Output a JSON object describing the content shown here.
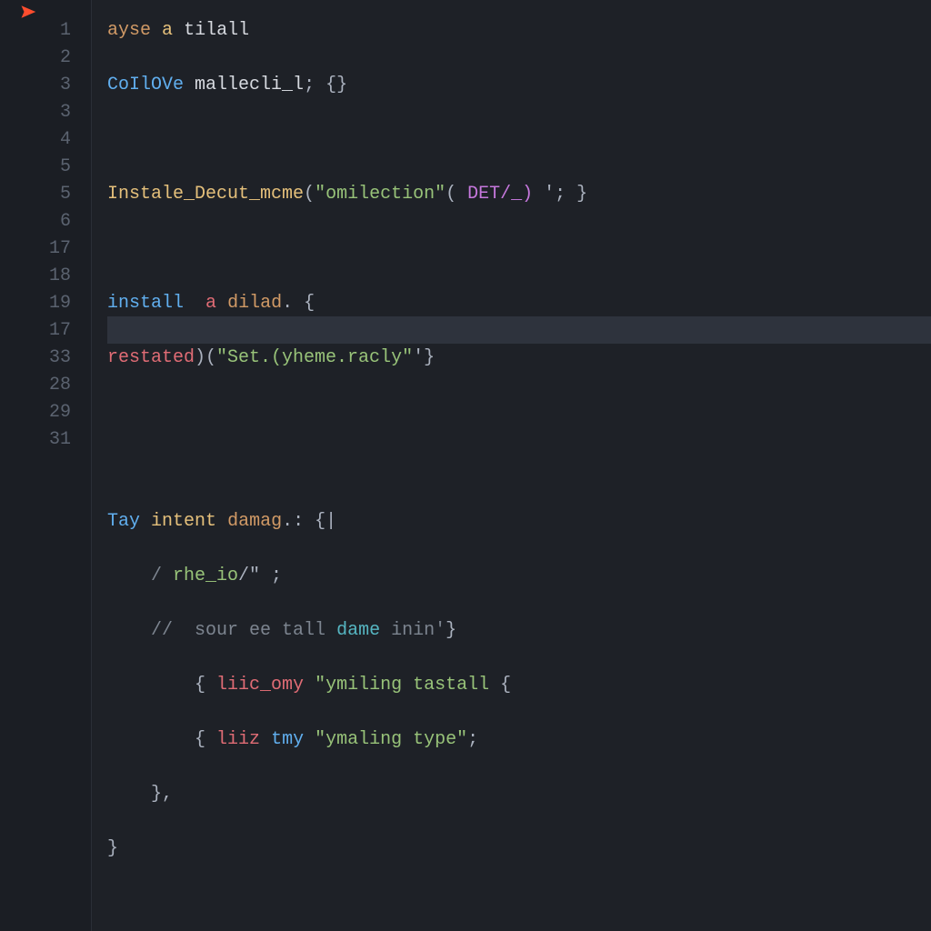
{
  "icon": {
    "name": "cursor-icon"
  },
  "gutter": {
    "numbers": [
      "1",
      "2",
      "3",
      "3",
      "4",
      "5",
      "5",
      "6",
      "17",
      "18",
      "19",
      "17",
      "33",
      "28",
      "29",
      "31"
    ]
  },
  "highlight": {
    "lineIndex": 11
  },
  "code": {
    "lines": [
      {
        "indent": 0,
        "tokens": [
          {
            "t": "ayse",
            "c": "c-id2"
          },
          {
            "t": " ",
            "c": "c-def"
          },
          {
            "t": "a",
            "c": "c-id"
          },
          {
            "t": " ",
            "c": "c-def"
          },
          {
            "t": "tilall",
            "c": "c-white"
          }
        ]
      },
      {
        "indent": 0,
        "tokens": [
          {
            "t": "CoIlOVe",
            "c": "c-key"
          },
          {
            "t": " ",
            "c": "c-def"
          },
          {
            "t": "mallecli_l",
            "c": "c-white"
          },
          {
            "t": "; ",
            "c": "c-punc"
          },
          {
            "t": "{}",
            "c": "c-punc"
          }
        ]
      },
      {
        "indent": 0,
        "tokens": []
      },
      {
        "indent": 0,
        "tokens": [
          {
            "t": "Instale_Decut_mcme",
            "c": "c-id"
          },
          {
            "t": "(",
            "c": "c-punc"
          },
          {
            "t": "\"omilection\"",
            "c": "c-str"
          },
          {
            "t": "( ",
            "c": "c-punc"
          },
          {
            "t": "DET/_)",
            "c": "c-pink"
          },
          {
            "t": " ",
            "c": "c-def"
          },
          {
            "t": "'; }",
            "c": "c-punc"
          }
        ]
      },
      {
        "indent": 0,
        "tokens": []
      },
      {
        "indent": 0,
        "tokens": [
          {
            "t": "install",
            "c": "c-key"
          },
          {
            "t": "  ",
            "c": "c-def"
          },
          {
            "t": "a",
            "c": "c-call"
          },
          {
            "t": " ",
            "c": "c-def"
          },
          {
            "t": "dilad",
            "c": "c-id2"
          },
          {
            "t": ". {",
            "c": "c-punc"
          }
        ]
      },
      {
        "indent": 0,
        "tokens": [
          {
            "t": "restated",
            "c": "c-call"
          },
          {
            "t": ")(",
            "c": "c-punc"
          },
          {
            "t": "\"Set.(yheme.racly\"",
            "c": "c-str"
          },
          {
            "t": "'}",
            "c": "c-punc"
          }
        ]
      },
      {
        "indent": 0,
        "tokens": []
      },
      {
        "indent": 0,
        "tokens": []
      },
      {
        "indent": 0,
        "tokens": [
          {
            "t": "Tay",
            "c": "c-key"
          },
          {
            "t": " ",
            "c": "c-def"
          },
          {
            "t": "intent",
            "c": "c-id"
          },
          {
            "t": " ",
            "c": "c-def"
          },
          {
            "t": "damag",
            "c": "c-id2"
          },
          {
            "t": ".: {|",
            "c": "c-punc"
          }
        ]
      },
      {
        "indent": 1,
        "tokens": [
          {
            "t": "/ ",
            "c": "c-comm"
          },
          {
            "t": "rhe_io",
            "c": "c-str"
          },
          {
            "t": "/\" ;",
            "c": "c-punc"
          }
        ]
      },
      {
        "indent": 1,
        "tokens": [
          {
            "t": "//  sour ee tall ",
            "c": "c-comm"
          },
          {
            "t": "dame",
            "c": "c-type"
          },
          {
            "t": " inin'",
            "c": "c-comm"
          },
          {
            "t": "}",
            "c": "c-punc"
          }
        ]
      },
      {
        "indent": 2,
        "tokens": [
          {
            "t": "{ ",
            "c": "c-punc"
          },
          {
            "t": "liic_omy",
            "c": "c-call"
          },
          {
            "t": " ",
            "c": "c-def"
          },
          {
            "t": "\"ymiling tastall",
            "c": "c-str"
          },
          {
            "t": " {",
            "c": "c-punc"
          }
        ]
      },
      {
        "indent": 2,
        "tokens": [
          {
            "t": "{ ",
            "c": "c-punc"
          },
          {
            "t": "liiz",
            "c": "c-call"
          },
          {
            "t": " ",
            "c": "c-def"
          },
          {
            "t": "tmy",
            "c": "c-key"
          },
          {
            "t": " ",
            "c": "c-def"
          },
          {
            "t": "\"ymaling type\"",
            "c": "c-str"
          },
          {
            "t": ";",
            "c": "c-punc"
          }
        ]
      },
      {
        "indent": 1,
        "tokens": [
          {
            "t": "},",
            "c": "c-punc"
          }
        ]
      },
      {
        "indent": 0,
        "tokens": [
          {
            "t": "}",
            "c": "c-punc"
          }
        ]
      }
    ]
  }
}
